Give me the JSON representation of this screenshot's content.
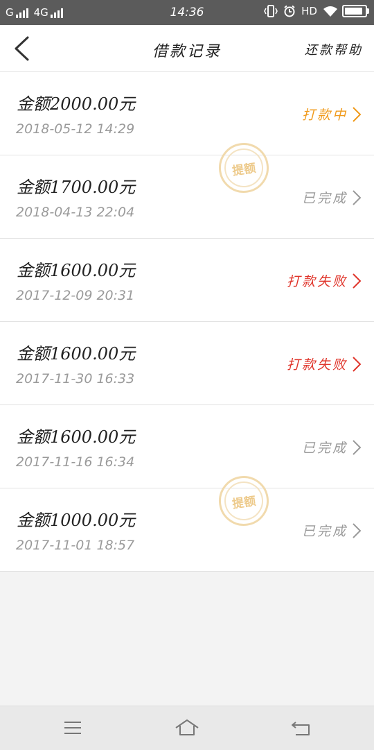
{
  "status_bar": {
    "carrier1": "G",
    "network": "4G",
    "time": "14:36",
    "hd": "HD",
    "battery_level": 0.95
  },
  "header": {
    "title": "借款记录",
    "help": "还款帮助"
  },
  "records": [
    {
      "amount": "金额2000.00元",
      "date": "2018-05-12 14:29",
      "status": "打款中",
      "status_color": "#f09a1b"
    },
    {
      "amount": "金额1700.00元",
      "date": "2018-04-13 22:04",
      "status": "已完成",
      "status_color": "#9a9a9a"
    },
    {
      "amount": "金额1600.00元",
      "date": "2017-12-09 20:31",
      "status": "打款失败",
      "status_color": "#e0352b"
    },
    {
      "amount": "金额1600.00元",
      "date": "2017-11-30 16:33",
      "status": "打款失败",
      "status_color": "#e0352b"
    },
    {
      "amount": "金额1600.00元",
      "date": "2017-11-16 16:34",
      "status": "已完成",
      "status_color": "#9a9a9a"
    },
    {
      "amount": "金额1000.00元",
      "date": "2017-11-01 18:57",
      "status": "已完成",
      "status_color": "#9a9a9a"
    }
  ],
  "stamp_text": "提额",
  "icons": {
    "back": "back-arrow-icon",
    "chevron": "chevron-right-icon",
    "menu": "menu-icon",
    "home": "home-icon",
    "return": "return-icon"
  }
}
